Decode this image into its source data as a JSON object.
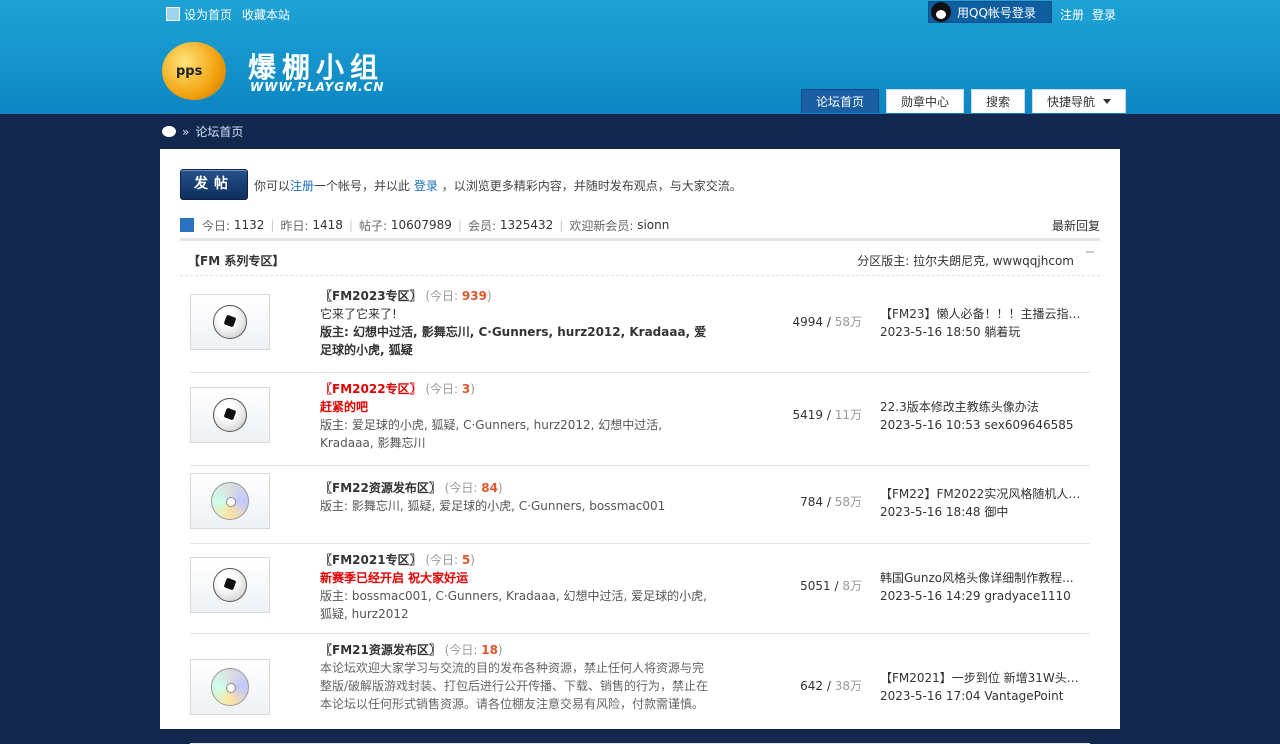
{
  "toplinks": {
    "set_home": "设为首页",
    "favorite": "收藏本站"
  },
  "qq_login": "用QQ帐号登录",
  "register": "注册",
  "login": "登录",
  "logo": {
    "title": "爆棚小组",
    "url": "WWW.PLAYGM.CN",
    "badge": "pps"
  },
  "nav": [
    {
      "label": "论坛首页"
    },
    {
      "label": "勋章中心"
    },
    {
      "label": "搜索"
    },
    {
      "label": "快捷导航"
    }
  ],
  "breadcrumb": {
    "sep": "»",
    "label": "论坛首页"
  },
  "post_button": "发帖",
  "welcome": {
    "prefix": "你可以",
    "reg": "注册",
    "mid": "一个帐号，并以此",
    "login": "登录",
    "suffix": "，以浏览更多精彩内容，并随时发布观点，与大家交流。"
  },
  "stats": {
    "today_label": "今日:",
    "today": "1132",
    "yesterday_label": "昨日:",
    "yesterday": "1418",
    "posts_label": "帖子:",
    "posts": "10607989",
    "members_label": "会员:",
    "members": "1325432",
    "newest_label": "欢迎新会员:",
    "newest": "sionn",
    "latest_reply": "最新回复"
  },
  "category": {
    "name": "【FM 系列专区】",
    "mods_label": "分区版主:",
    "mods": "拉尔夫朗尼克, wwwqqjhcom"
  },
  "forums": [
    {
      "title": "〖FM2023专区〗",
      "title_red": false,
      "today_label": "(今日: ",
      "today": "939",
      "today_end": ")",
      "desc": "它来了它来了!",
      "desc_style": "",
      "mod_label": "版主: ",
      "mods": "幻想中过活, 影舞忘川, C·Gunners, hurz2012, Kradaaa, 爱足球的小虎, 狐疑",
      "mod_bold": true,
      "threads": "4994",
      "posts": "58万",
      "last_title": "【FM23】懒人必备！！！主播云指导...",
      "last_date": "2023-5-16 18:50 躺着玩",
      "icon": "football"
    },
    {
      "title": "〖FM2022专区〗",
      "title_red": true,
      "today_label": "(今日: ",
      "today": "3",
      "today_end": ")",
      "desc": "赶紧的吧",
      "desc_style": "red",
      "mod_label": "版主: ",
      "mods": "爱足球的小虎, 狐疑, C·Gunners, hurz2012, 幻想中过活, Kradaaa, 影舞忘川",
      "mod_bold": false,
      "threads": "5419",
      "posts": "11万",
      "last_title": "22.3版本修改主教练头像办法",
      "last_date": "2023-5-16 10:53 sex609646585",
      "icon": "football"
    },
    {
      "title": "〖FM22资源发布区〗",
      "title_red": false,
      "today_label": "(今日: ",
      "today": "84",
      "today_end": ")",
      "desc": "",
      "desc_style": "",
      "mod_label": "版主: ",
      "mods": "影舞忘川, 狐疑, 爱足球的小虎, C·Gunners, bossmac001",
      "mod_bold": false,
      "threads": "784",
      "posts": "58万",
      "last_title": "【FM22】FM2022实况风格随机人头...",
      "last_date": "2023-5-16 18:48 御中",
      "icon": "dvd"
    },
    {
      "title": "〖FM2021专区〗",
      "title_red": false,
      "today_label": "(今日: ",
      "today": "5",
      "today_end": ")",
      "desc": "新赛季已经开启 祝大家好运",
      "desc_style": "red",
      "mod_label": "版主: ",
      "mods": "bossmac001, C·Gunners, Kradaaa, 幻想中过活, 爱足球的小虎, 狐疑, hurz2012",
      "mod_bold": false,
      "threads": "5051",
      "posts": "8万",
      "last_title": "韩国Gunzo风格头像详细制作教程...",
      "last_date": "2023-5-16 14:29 gradyace1110",
      "icon": "football"
    },
    {
      "title": "〖FM21资源发布区〗",
      "title_red": false,
      "today_label": "(今日: ",
      "today": "18",
      "today_end": ")",
      "desc": "本论坛欢迎大家学习与交流的目的发布各种资源，禁止任何人将资源与完整版/破解版游戏封装、打包后进行公开传播、下载、销售的行为，禁止在本论坛以任何形式销售资源。请各位棚友注意交易有风险，付款需谨慎。",
      "desc_style": "grey",
      "mod_label": "",
      "mods": "",
      "mod_bold": false,
      "threads": "642",
      "posts": "38万",
      "last_title": "【FM2021】一步到位 新增31W头像...",
      "last_date": "2023-5-16 17:04 VantagePoint",
      "icon": "dvd"
    }
  ]
}
